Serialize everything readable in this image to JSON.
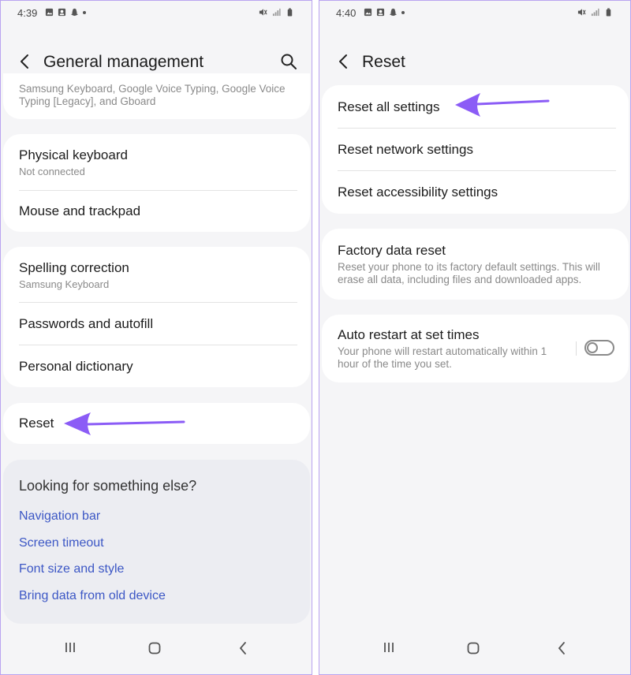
{
  "left_screen": {
    "status": {
      "time": "4:39"
    },
    "header": {
      "title": "General management"
    },
    "partial_card": {
      "subtitle": "Samsung Keyboard, Google Voice Typing, Google Voice Typing [Legacy], and Gboard"
    },
    "keyboard_card": {
      "items": [
        {
          "title": "Physical keyboard",
          "subtitle": "Not connected"
        },
        {
          "title": "Mouse and trackpad"
        }
      ]
    },
    "spelling_card": {
      "items": [
        {
          "title": "Spelling correction",
          "subtitle": "Samsung Keyboard"
        },
        {
          "title": "Passwords and autofill"
        },
        {
          "title": "Personal dictionary"
        }
      ]
    },
    "reset_card": {
      "title": "Reset"
    },
    "suggestions": {
      "heading": "Looking for something else?",
      "links": [
        "Navigation bar",
        "Screen timeout",
        "Font size and style",
        "Bring data from old device"
      ]
    }
  },
  "right_screen": {
    "status": {
      "time": "4:40"
    },
    "header": {
      "title": "Reset"
    },
    "reset_card": {
      "items": [
        {
          "title": "Reset all settings"
        },
        {
          "title": "Reset network settings"
        },
        {
          "title": "Reset accessibility settings"
        }
      ]
    },
    "factory_card": {
      "title": "Factory data reset",
      "subtitle": "Reset your phone to its factory default settings. This will erase all data, including files and downloaded apps."
    },
    "auto_restart_card": {
      "title": "Auto restart at set times",
      "subtitle": "Your phone will restart automatically within 1 hour of the time you set.",
      "toggle_on": false
    }
  },
  "colors": {
    "arrow": "#8b5cf6",
    "link": "#3c57c5",
    "background": "#f5f5f7"
  },
  "icons": [
    "back-arrow-icon",
    "search-icon",
    "recents-icon",
    "home-icon",
    "nav-back-icon",
    "gallery-icon",
    "contacts-icon",
    "snapchat-icon",
    "mute-icon",
    "signal-icon",
    "battery-icon"
  ]
}
